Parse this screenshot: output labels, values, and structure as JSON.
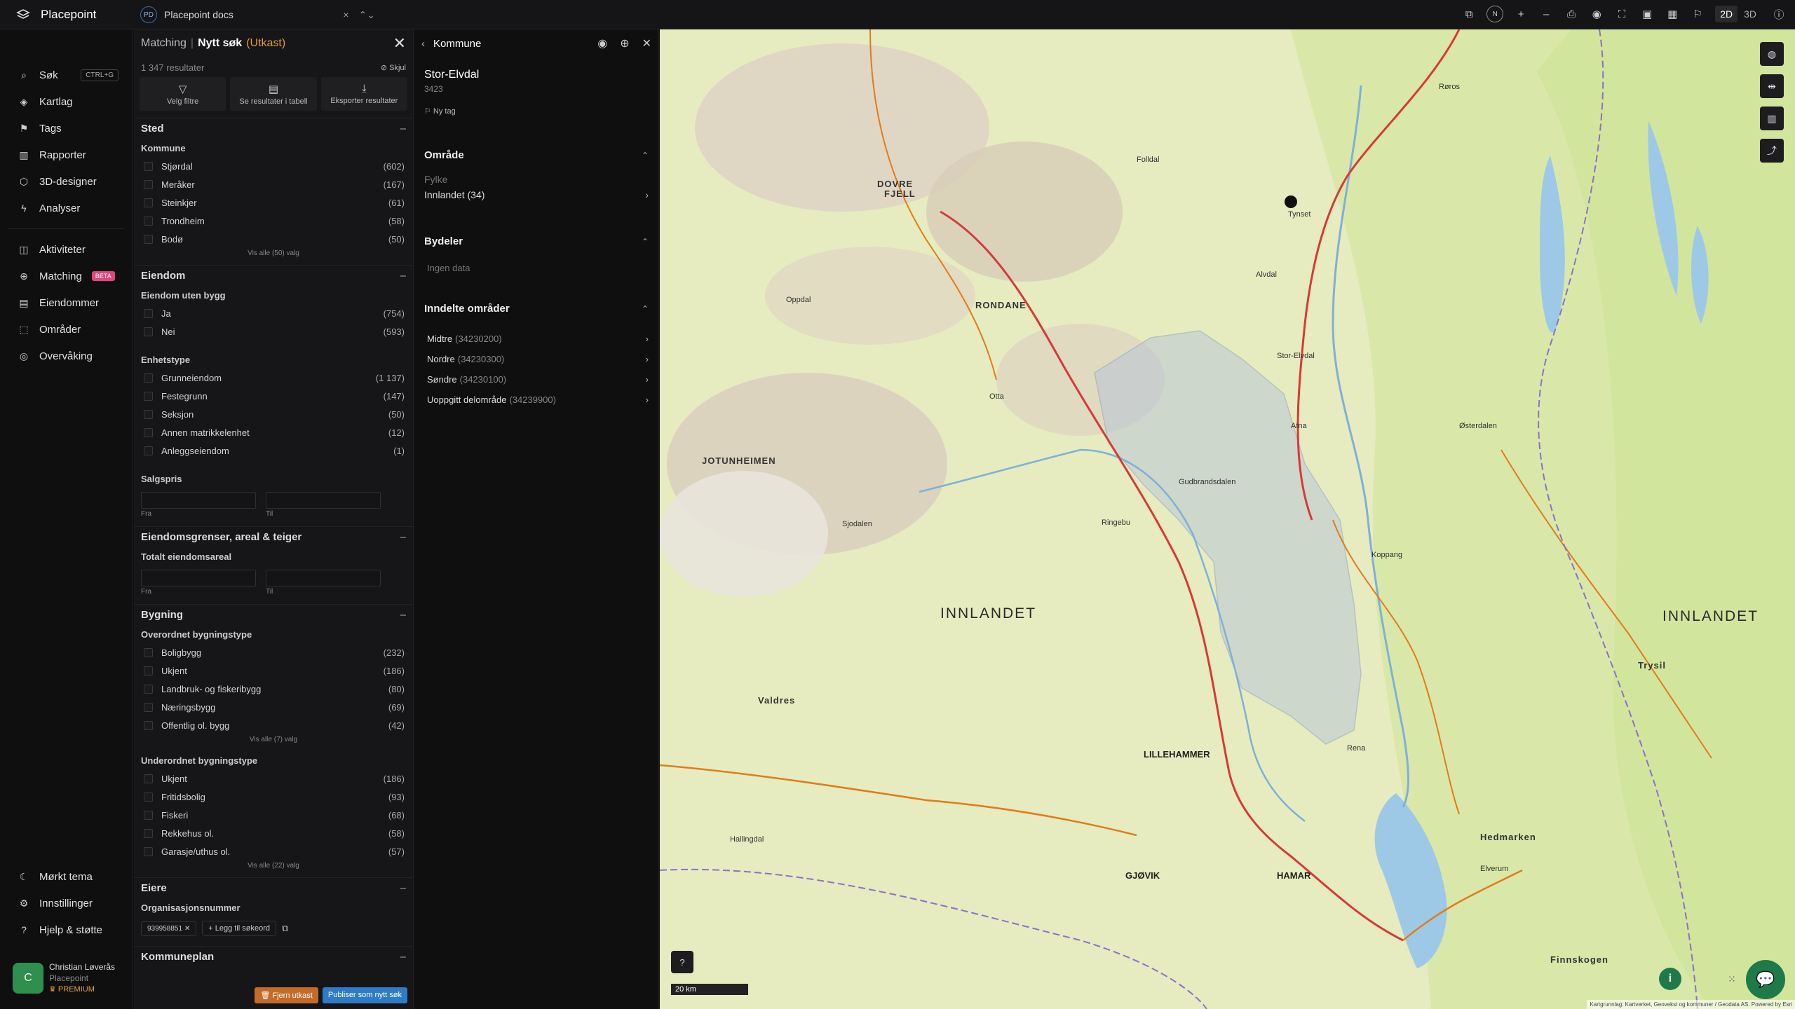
{
  "app": {
    "name": "Placepoint"
  },
  "workspace": {
    "badge": "PD",
    "name": "Placepoint docs",
    "clear": "×",
    "switch": "⌃⌄"
  },
  "toolbar": {
    "compass": "N",
    "zoom_in": "+",
    "zoom_out": "–",
    "mode_2d": "2D",
    "mode_3d": "3D"
  },
  "sidebar": {
    "items": [
      {
        "label": "Søk",
        "icon": "search-icon",
        "kbd": "CTRL+G"
      },
      {
        "label": "Kartlag",
        "icon": "layers-icon"
      },
      {
        "label": "Tags",
        "icon": "bookmark-icon"
      },
      {
        "label": "Rapporter",
        "icon": "chart-icon"
      },
      {
        "label": "3D-designer",
        "icon": "cube-icon"
      },
      {
        "label": "Analyser",
        "icon": "bolt-icon"
      }
    ],
    "items2": [
      {
        "label": "Aktiviteter",
        "icon": "chat-icon"
      },
      {
        "label": "Matching",
        "icon": "match-icon",
        "badge": "BETA"
      },
      {
        "label": "Eiendommer",
        "icon": "building-icon"
      },
      {
        "label": "Områder",
        "icon": "area-icon"
      },
      {
        "label": "Overvåking",
        "icon": "monitor-icon"
      }
    ],
    "bottom": [
      {
        "label": "Mørkt tema",
        "icon": "moon-icon"
      },
      {
        "label": "Innstillinger",
        "icon": "gear-icon"
      },
      {
        "label": "Hjelp & støtte",
        "icon": "help-icon"
      }
    ],
    "user": {
      "initial": "C",
      "name": "Christian Løverås",
      "org": "Placepoint",
      "tier": "PREMIUM"
    }
  },
  "filters": {
    "crumb": "Matching",
    "sep": "|",
    "title": "Nytt søk",
    "draft": "(Utkast)",
    "results": "1 347 resultater",
    "hide": "Skjul",
    "buttons": {
      "filter": "Velg filtre",
      "table": "Se resultater i tabell",
      "export": "Eksporter resultater"
    },
    "sted": {
      "title": "Sted",
      "kommune_label": "Kommune",
      "options": [
        {
          "label": "Stjørdal",
          "count": "(602)"
        },
        {
          "label": "Meråker",
          "count": "(167)"
        },
        {
          "label": "Steinkjer",
          "count": "(61)"
        },
        {
          "label": "Trondheim",
          "count": "(58)"
        },
        {
          "label": "Bodø",
          "count": "(50)"
        }
      ],
      "show_all": "Vis alle (50) valg"
    },
    "eiendom": {
      "title": "Eiendom",
      "uten_bygg_label": "Eiendom uten bygg",
      "uten_bygg": [
        {
          "label": "Ja",
          "count": "(754)"
        },
        {
          "label": "Nei",
          "count": "(593)"
        }
      ],
      "enhet_label": "Enhetstype",
      "enhet": [
        {
          "label": "Grunneiendom",
          "count": "(1 137)"
        },
        {
          "label": "Festegrunn",
          "count": "(147)"
        },
        {
          "label": "Seksjon",
          "count": "(50)"
        },
        {
          "label": "Annen matrikkelenhet",
          "count": "(12)"
        },
        {
          "label": "Anleggseiendom",
          "count": "(1)"
        }
      ],
      "salgspris_label": "Salgspris",
      "from": "Fra",
      "to": "Til"
    },
    "grenser": {
      "title": "Eiendomsgrenser, areal & teiger",
      "areal_label": "Totalt eiendomsareal",
      "from": "Fra",
      "to": "Til"
    },
    "bygning": {
      "title": "Bygning",
      "overordnet_label": "Overordnet bygningstype",
      "overordnet": [
        {
          "label": "Boligbygg",
          "count": "(232)"
        },
        {
          "label": "Ukjent",
          "count": "(186)"
        },
        {
          "label": "Landbruk- og fiskeribygg",
          "count": "(80)"
        },
        {
          "label": "Næringsbygg",
          "count": "(69)"
        },
        {
          "label": "Offentlig ol. bygg",
          "count": "(42)"
        }
      ],
      "overordnet_all": "Vis alle (7) valg",
      "underordnet_label": "Underordnet bygningstype",
      "underordnet": [
        {
          "label": "Ukjent",
          "count": "(186)"
        },
        {
          "label": "Fritidsbolig",
          "count": "(93)"
        },
        {
          "label": "Fiskeri",
          "count": "(68)"
        },
        {
          "label": "Rekkehus ol.",
          "count": "(58)"
        },
        {
          "label": "Garasje/uthus ol.",
          "count": "(57)"
        }
      ],
      "underordnet_all": "Vis alle (22) valg"
    },
    "eiere": {
      "title": "Eiere",
      "org_label": "Organisasjonsnummer",
      "chip": "939958851",
      "add_keyword": "Legg til søkeord"
    },
    "kommuneplan": {
      "title": "Kommuneplan"
    },
    "remove_draft": "Fjern utkast",
    "publish": "Publiser som nytt søk"
  },
  "kommune": {
    "header": "Kommune",
    "name": "Stor-Elvdal",
    "code": "3423",
    "new_tag": "Ny tag",
    "omrade_title": "Område",
    "fylke_label": "Fylke",
    "fylke_value": "Innlandet (34)",
    "bydeler_title": "Bydeler",
    "bydeler_empty": "Ingen data",
    "inndelte_title": "Inndelte områder",
    "inndelte": [
      {
        "name": "Midtre",
        "code": "(34230200)"
      },
      {
        "name": "Nordre",
        "code": "(34230300)"
      },
      {
        "name": "Søndre",
        "code": "(34230100)"
      },
      {
        "name": "Uoppgitt delområde",
        "code": "(34239900)"
      }
    ]
  },
  "map": {
    "scale": "20 km",
    "help": "?",
    "info": "i",
    "attribution": "Kartgrunnlag: Kartverket, Geovekst og kommuner / Geodata AS. Powered by Esri",
    "labels": {
      "innlandet_w": "INNLANDET",
      "innlandet_e": "INNLANDET",
      "rondane": "RONDANE",
      "dovre": "DOVRE",
      "fjell": "FJELL",
      "jotunheimen": "JOTUNHEIMEN",
      "tynset": "Tynset",
      "roros": "Røros",
      "hamar": "HAMAR",
      "gjovik": "GJØVIK",
      "lillehammer": "LILLEHAMMER",
      "hedmarken": "Hedmarken",
      "valdres": "Valdres",
      "ringebu": "Ringebu",
      "otta": "Otta",
      "oppdal": "Oppdal",
      "sjodalen": "Sjodalen",
      "elverum": "Elverum",
      "rena": "Rena",
      "koppang": "Koppang",
      "atna": "Atna",
      "alvdal": "Alvdal",
      "trysil": "Trysil",
      "osterdalen": "Østerdalen",
      "gudbrandsdalen": "Gudbrandsdalen",
      "hadeland": "Hallingdal",
      "finnskogen": "Finnskogen",
      "folldal": "Folldal",
      "stor_elvdal": "Stor-Elvdal"
    }
  }
}
